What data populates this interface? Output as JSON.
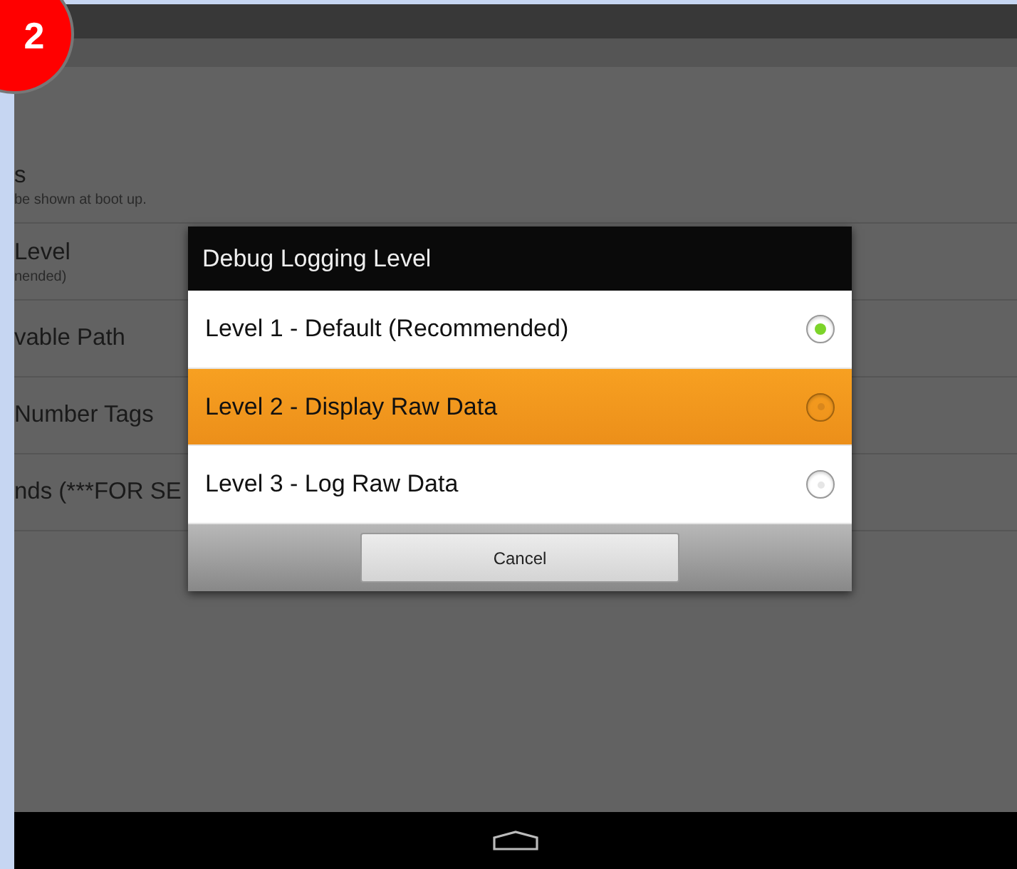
{
  "step_badge": {
    "label": "2"
  },
  "settings": [
    {
      "title": "s",
      "summary": "be shown at boot up."
    },
    {
      "title": "Level",
      "summary": "nended)"
    },
    {
      "title": "vable Path"
    },
    {
      "title": "Number Tags"
    },
    {
      "title": "nds (***FOR SE"
    }
  ],
  "dialog": {
    "title": "Debug Logging Level",
    "options": [
      {
        "label": "Level 1 - Default (Recommended)",
        "selected": true,
        "pressed": false
      },
      {
        "label": "Level 2 - Display Raw Data",
        "selected": false,
        "pressed": true
      },
      {
        "label": "Level 3 - Log Raw Data",
        "selected": false,
        "pressed": false
      }
    ],
    "buttons": [
      "Cancel"
    ]
  }
}
